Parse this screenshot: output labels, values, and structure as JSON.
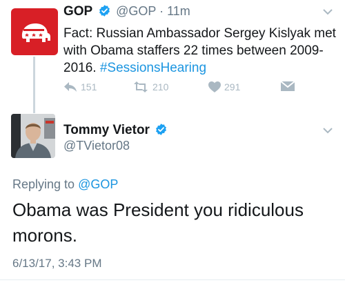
{
  "parent_tweet": {
    "author_name": "GOP",
    "author_handle": "@GOP",
    "separator": " · ",
    "time_ago": "11m",
    "avatar_icon": "republican-elephant-logo",
    "text_main": "Fact: Russian Ambassador Sergey Kislyak met with Obama staffers 22 times between 2009-2016. ",
    "hashtag": "#SessionsHearing",
    "actions": {
      "reply_count": "151",
      "retweet_count": "210",
      "like_count": "291"
    }
  },
  "reply_tweet": {
    "author_name": "Tommy Vietor",
    "author_handle": "@TVietor08",
    "replying_to_label": "Replying to ",
    "replying_to_handle": "@GOP",
    "text": "Obama was President you ridiculous morons.",
    "timestamp": "6/13/17, 3:43 PM"
  },
  "colors": {
    "link_blue": "#1b95e0",
    "verified_blue": "#1da1f2",
    "gop_red": "#d81f26",
    "muted_gray": "#657786",
    "icon_gray": "#aab8c2"
  }
}
